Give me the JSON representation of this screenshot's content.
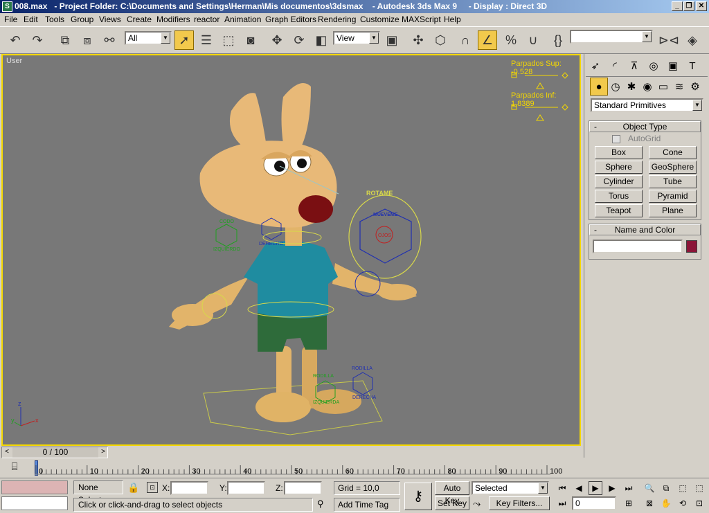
{
  "window": {
    "icon": "3ds-max-icon",
    "title": "008.max   - Project Folder: C:\\Documents and Settings\\Herman\\Mis documentos\\3dsmax    - Autodesk 3ds Max 9     - Display : Direct 3D",
    "minimize": "_",
    "maximize": "❐",
    "close": "✕"
  },
  "menu": [
    "File",
    "Edit",
    "Tools",
    "Group",
    "Views",
    "Create",
    "Modifiers",
    "reactor",
    "Animation",
    "Graph Editors",
    "Rendering",
    "Customize",
    "MAXScript",
    "Help"
  ],
  "toolbar": {
    "selection_filter": "All",
    "reference_coord": "View",
    "named_selection": ""
  },
  "viewport": {
    "label": "User",
    "slider_top_label": "Parpados Sup: -0.528",
    "slider_bottom_label": "Parpados Inf: 1.8389",
    "axis_z": "z",
    "axis_y": "y",
    "axis_x": "x",
    "rig_labels": {
      "rotame": "ROTAME",
      "mueveme": "MUEVEME",
      "ojos": "OJOS",
      "codo": "CODO",
      "izquierdo": "IZQUIERDO",
      "derecho": "DERECHO",
      "rodilla_l": "RODILLA",
      "izquierda": "IZQUIERDA",
      "rodilla_r": "RODILLA",
      "derecha": "DERECHA"
    }
  },
  "command_panel": {
    "category": "Standard Primitives",
    "object_type_title": "Object Type",
    "autogrid": "AutoGrid",
    "primitives": [
      "Box",
      "Cone",
      "Sphere",
      "GeoSphere",
      "Cylinder",
      "Tube",
      "Torus",
      "Pyramid",
      "Teapot",
      "Plane"
    ],
    "name_color_title": "Name and Color",
    "object_name": "",
    "object_color": "#8b1538"
  },
  "timeline": {
    "frame_display": "0 / 100",
    "ticks": [
      "0",
      "10",
      "20",
      "30",
      "40",
      "50",
      "60",
      "70",
      "80",
      "90",
      "100"
    ]
  },
  "status": {
    "selection": "None Selecte",
    "x_label": "X:",
    "y_label": "Y:",
    "z_label": "Z:",
    "x_value": "",
    "y_value": "",
    "z_value": "",
    "grid": "Grid = 10,0",
    "prompt": "Click or click-and-drag to select objects",
    "add_time_tag": "Add Time Tag",
    "auto_key": "Auto Key",
    "set_key": "Set Key",
    "key_mode": "Selected",
    "key_filters": "Key Filters...",
    "current_frame": "0"
  },
  "colors": {
    "viewport_bg": "#787878",
    "active_border": "#f5d800",
    "titlebar": "#0a246a"
  }
}
